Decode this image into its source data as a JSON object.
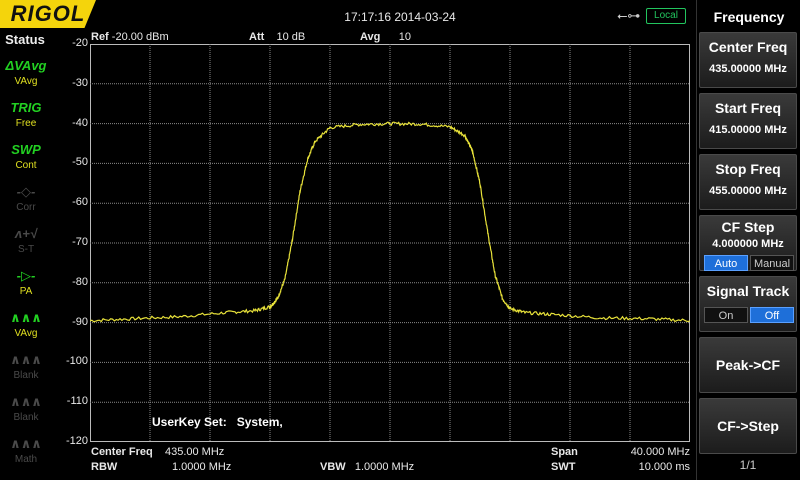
{
  "header": {
    "logo": "RIGOL",
    "datetime": "17:17:16 2014-03-24",
    "usb_icon": "usb-icon",
    "local_label": "Local"
  },
  "status": {
    "title": "Status",
    "items": [
      {
        "icon": "ΔVAvg",
        "label": "VAvg",
        "state": "active"
      },
      {
        "icon": "TRIG",
        "label": "Free",
        "state": "active"
      },
      {
        "icon": "SWP",
        "label": "Cont",
        "state": "active"
      },
      {
        "icon": "-◇-",
        "label": "Corr",
        "state": "dim"
      },
      {
        "icon": "ʌ+√",
        "label": "S-T",
        "state": "dim"
      },
      {
        "icon": "-▷-",
        "label": "PA",
        "state": "active"
      },
      {
        "icon": "∧∧∧",
        "label": "VAvg",
        "state": "active"
      },
      {
        "icon": "∧∧∧",
        "label": "Blank",
        "state": "dim"
      },
      {
        "icon": "∧∧∧",
        "label": "Blank",
        "state": "dim"
      },
      {
        "icon": "∧∧∧",
        "label": "Math",
        "state": "dim"
      }
    ]
  },
  "measure": {
    "ref_label": "Ref",
    "ref_value": "-20.00 dBm",
    "att_label": "Att",
    "att_value": "10 dB",
    "avg_label": "Avg",
    "avg_value": "10",
    "y_ticks": [
      "-20",
      "-30",
      "-40",
      "-50",
      "-60",
      "-70",
      "-80",
      "-90",
      "-100",
      "-110",
      "-120"
    ],
    "userkey_label": "UserKey Set:",
    "userkey_value": "System,"
  },
  "footer": {
    "center_freq_label": "Center Freq",
    "center_freq_value": "435.00 MHz",
    "rbw_label": "RBW",
    "rbw_value": "1.0000 MHz",
    "vbw_label": "VBW",
    "vbw_value": "1.0000 MHz",
    "span_label": "Span",
    "span_value": "40.000 MHz",
    "swt_label": "SWT",
    "swt_value": "10.000 ms"
  },
  "menu": {
    "title": "Frequency",
    "center_freq": {
      "label": "Center Freq",
      "value": "435.00000 MHz"
    },
    "start_freq": {
      "label": "Start Freq",
      "value": "415.00000 MHz"
    },
    "stop_freq": {
      "label": "Stop Freq",
      "value": "455.00000 MHz"
    },
    "cf_step": {
      "label": "CF Step",
      "value": "4.000000 MHz",
      "opt_a": "Auto",
      "opt_b": "Manual"
    },
    "signal_track": {
      "label": "Signal Track",
      "opt_a": "On",
      "opt_b": "Off"
    },
    "peak_cf": "Peak->CF",
    "cf_step_btn": "CF->Step",
    "page": "1/1"
  },
  "colors": {
    "trace": "#e8e23a",
    "grid": "#8a8a8a",
    "logo_bg": "#f4d40c",
    "accent": "#1e6fd9",
    "local": "#22c55e"
  },
  "chart_data": {
    "type": "line",
    "x_range_mhz": [
      415,
      455
    ],
    "ylim": [
      -120,
      -20
    ],
    "y_unit": "dBm",
    "series": [
      {
        "x": [
          415,
          418,
          421,
          424,
          426,
          427,
          427.5,
          428,
          428.5,
          429,
          429.5,
          430,
          431,
          433,
          435,
          437,
          439,
          440,
          440.5,
          441,
          441.5,
          442,
          442.5,
          443,
          444,
          446,
          449,
          452,
          455
        ],
        "y": [
          -89.5,
          -89,
          -88.5,
          -87.5,
          -87,
          -86,
          -84,
          -79,
          -69,
          -57,
          -49,
          -44.5,
          -41,
          -40.2,
          -40,
          -40.1,
          -40.8,
          -43,
          -47,
          -55,
          -67,
          -78,
          -84,
          -86.5,
          -87.5,
          -88,
          -88.8,
          -89,
          -89.5
        ]
      }
    ]
  }
}
